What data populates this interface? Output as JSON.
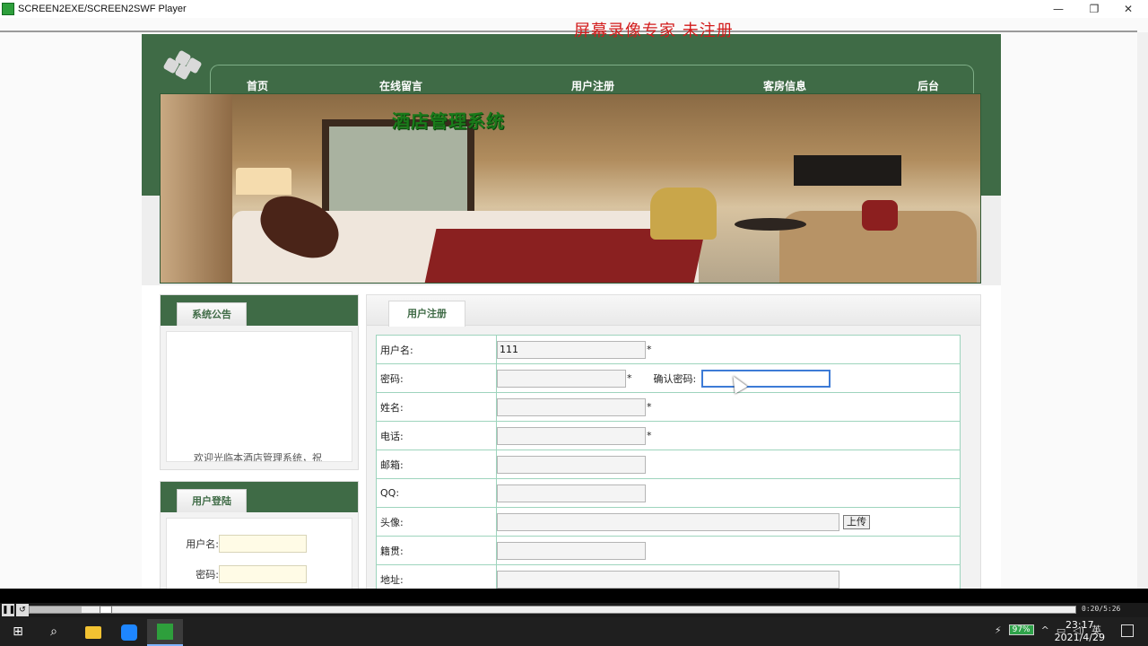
{
  "player": {
    "title": "SCREEN2EXE/SCREEN2SWF Player",
    "watermark": "屏幕录像专家  未注册",
    "time": "0:20/5:26",
    "progress_fraction": 0.05
  },
  "site": {
    "nav": [
      "首页",
      "在线留言",
      "用户注册",
      "客房信息",
      "后台"
    ],
    "banner_title": "酒店管理系统",
    "notice": {
      "tab": "系统公告",
      "text": "欢迎光临本酒店管理系统，祝"
    },
    "login": {
      "tab": "用户登陆",
      "username_label": "用户名:",
      "password_label": "密码:"
    },
    "register": {
      "tab": "用户注册",
      "fields": {
        "username": {
          "label": "用户名:",
          "value": "111",
          "star": "*"
        },
        "password": {
          "label": "密码:",
          "star": "*",
          "confirm_label": "确认密码:"
        },
        "name": {
          "label": "姓名:",
          "star": "*"
        },
        "phone": {
          "label": "电话:",
          "star": "*"
        },
        "email": {
          "label": "邮箱:"
        },
        "qq": {
          "label": "QQ:"
        },
        "avatar": {
          "label": "头像:",
          "button": "上传"
        },
        "hometown": {
          "label": "籍贯:"
        },
        "address": {
          "label": "地址:"
        }
      }
    }
  },
  "taskbar": {
    "battery": "97%",
    "ime": "英",
    "time": "23:17",
    "date": "2021/4/29"
  }
}
